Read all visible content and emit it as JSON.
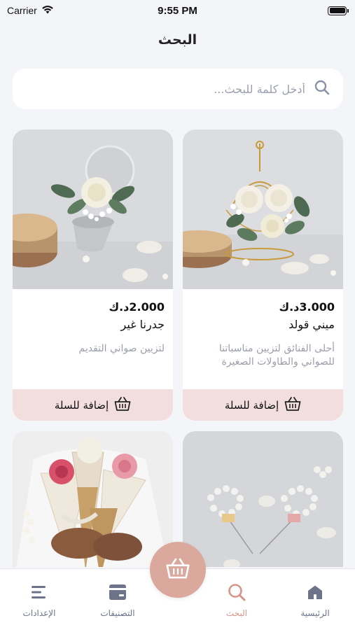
{
  "status_bar": {
    "carrier": "Carrier",
    "time": "9:55 PM"
  },
  "page_title": "البحث",
  "search": {
    "placeholder": "أدخل كلمة للبحث..."
  },
  "products": [
    {
      "price": "3.000د.ك",
      "name": "ميني قولد",
      "description": "أحلى الفنائق لتزيين مناسباتنا للصواني والطاولات الصغيرة",
      "add_label": "إضافة للسلة"
    },
    {
      "price": "2.000د.ك",
      "name": "جدرنا غير",
      "description": "لتزيين صواني التقديم",
      "add_label": "إضافة للسلة"
    },
    {
      "price": "",
      "name": "",
      "description": "",
      "add_label": ""
    },
    {
      "price": "",
      "name": "",
      "description": "",
      "add_label": ""
    }
  ],
  "tabbar": {
    "home": "الرئيسية",
    "search": "البحث",
    "categories": "التصنيفات",
    "settings": "الإعدادات"
  },
  "colors": {
    "accent": "#d4968a",
    "fab": "#dba89d",
    "add_button_bg": "#f3dede"
  },
  "icons": [
    "search-icon",
    "basket-icon",
    "home-icon",
    "categories-icon",
    "settings-icon",
    "wifi-icon",
    "battery-icon"
  ]
}
